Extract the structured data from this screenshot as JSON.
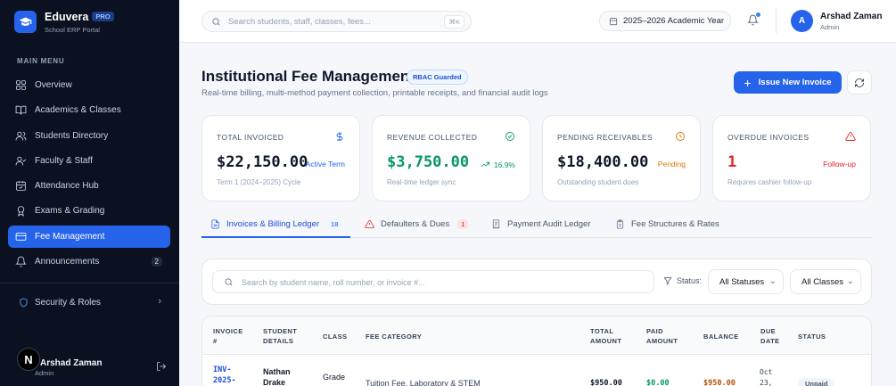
{
  "brand": {
    "name": "Eduvera",
    "badge": "PRO",
    "subtitle": "School ERP Portal"
  },
  "sidebar": {
    "heading": "MAIN MENU",
    "items": [
      {
        "label": "Overview",
        "icon": "layout-grid-icon"
      },
      {
        "label": "Academics & Classes",
        "icon": "book-icon"
      },
      {
        "label": "Students Directory",
        "icon": "users-icon"
      },
      {
        "label": "Faculty & Staff",
        "icon": "user-check-icon"
      },
      {
        "label": "Attendance Hub",
        "icon": "calendar-check-icon"
      },
      {
        "label": "Exams & Grading",
        "icon": "award-icon"
      },
      {
        "label": "Fee Management",
        "icon": "credit-card-icon",
        "active": true
      },
      {
        "label": "Announcements",
        "icon": "bell-icon",
        "count": "2"
      }
    ],
    "security": {
      "label": "Security & Roles",
      "chevron": "›"
    },
    "footer": {
      "avatar": "N",
      "name": "Arshad Zaman",
      "role": "Admin"
    }
  },
  "topbar": {
    "search_placeholder": "Search students, staff, classes, fees...",
    "shortcut": "⌘K",
    "academic_year": "2025–2026 Academic Year",
    "user": {
      "initial": "A",
      "name": "Arshad Zaman",
      "role": "Admin"
    }
  },
  "header": {
    "title": "Institutional Fee Management",
    "badge": "RBAC Guarded",
    "subtitle": "Real-time billing, multi-method payment collection, printable receipts, and financial audit logs",
    "issue_button": "Issue New Invoice",
    "issue_plus": "+"
  },
  "stats": [
    {
      "label": "TOTAL INVOICED",
      "value": "$22,150.00",
      "note": "Active Term",
      "sub": "Term 1 (2024–2025) Cycle",
      "icon": "dollar-icon",
      "color": "#2563eb"
    },
    {
      "label": "REVENUE COLLECTED",
      "value": "$3,750.00",
      "note": "16.9%",
      "sub": "Real-time ledger sync",
      "icon": "check-circle-icon",
      "color": "#059669"
    },
    {
      "label": "PENDING RECEIVABLES",
      "value": "$18,400.00",
      "note": "Pending",
      "sub": "Outstanding student dues",
      "icon": "clock-icon",
      "color": "#d97706"
    },
    {
      "label": "OVERDUE INVOICES",
      "value": "1",
      "note": "Follow-up",
      "sub": "Requires cashier follow-up",
      "icon": "alert-triangle-icon",
      "color": "#dc2626"
    }
  ],
  "tabs": [
    {
      "label": "Invoices & Billing Ledger",
      "badge": "18",
      "active": true
    },
    {
      "label": "Defaulters & Dues",
      "badge": "1"
    },
    {
      "label": "Payment Audit Ledger"
    },
    {
      "label": "Fee Structures & Rates"
    }
  ],
  "filters": {
    "search_placeholder": "Search by student name, roll number, or invoice #...",
    "status_label": "Status:",
    "status_value": "All Statuses",
    "class_value": "All Classes",
    "caret": "⌄"
  },
  "table": {
    "columns": [
      "INVOICE #",
      "STUDENT DETAILS",
      "CLASS",
      "FEE CATEGORY",
      "TOTAL AMOUNT",
      "PAID AMOUNT",
      "BALANCE",
      "DUE DATE",
      "STATUS"
    ],
    "rows": [
      {
        "invoice": "INV-2025-",
        "student": "Nathan Drake",
        "class": "Grade",
        "category": "Tuition Fee, Laboratory & STEM",
        "total": "$950.00",
        "paid": "$0.00",
        "balance": "$950.00",
        "due": "Oct 23,",
        "status": "Unpaid"
      }
    ]
  }
}
